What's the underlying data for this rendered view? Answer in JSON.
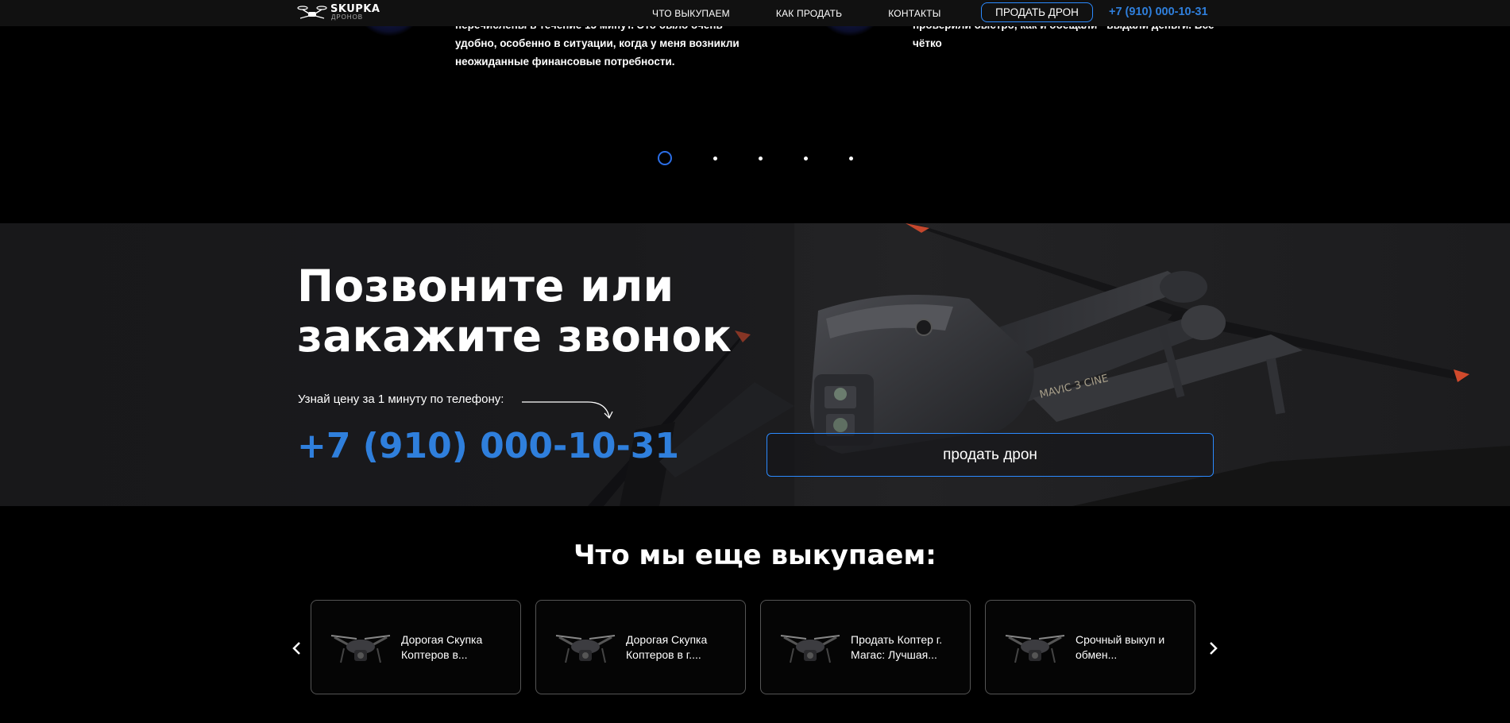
{
  "header": {
    "logo_main": "SKUPKA",
    "logo_sub": "ДРОНОВ",
    "nav": [
      "ЧТО ВЫКУПАЕМ",
      "КАК ПРОДАТЬ",
      "КОНТАКТЫ"
    ],
    "sell_button": "ПРОДАТЬ ДРОН",
    "phone": "+7 (910) 000-10-31"
  },
  "reviews": {
    "left_lines": [
      "перечислены в течение 15 минут. Это было очень",
      "удобно, особенно в ситуации, когда у меня возникли",
      "неожиданные финансовые потребности."
    ],
    "right_lines": [
      "проверили быстро, как и обещали - выдали деньги. Все",
      "чётко"
    ],
    "dots_count": 5,
    "active_dot": 1
  },
  "call": {
    "title_line1": "Позвоните или",
    "title_line2": "закажите звонок",
    "subtitle": "Узнай цену за 1 минуту по телефону:",
    "phone": "+7 (910) 000-10-31",
    "button": "продать дрон"
  },
  "more": {
    "title": "Что мы еще выкупаем:",
    "cards": [
      {
        "line1": "Дорогая Скупка",
        "line2": "Коптеров в..."
      },
      {
        "line1": "Дорогая Скупка",
        "line2": "Коптеров в г...."
      },
      {
        "line1": "Продать Коптер г.",
        "line2": "Магас: Лучшая..."
      },
      {
        "line1": "Срочный выкуп и",
        "line2": "обмен..."
      }
    ]
  },
  "colors": {
    "accent": "#2f7fdc",
    "border_blue": "#2b8aff",
    "bg": "#000000"
  }
}
